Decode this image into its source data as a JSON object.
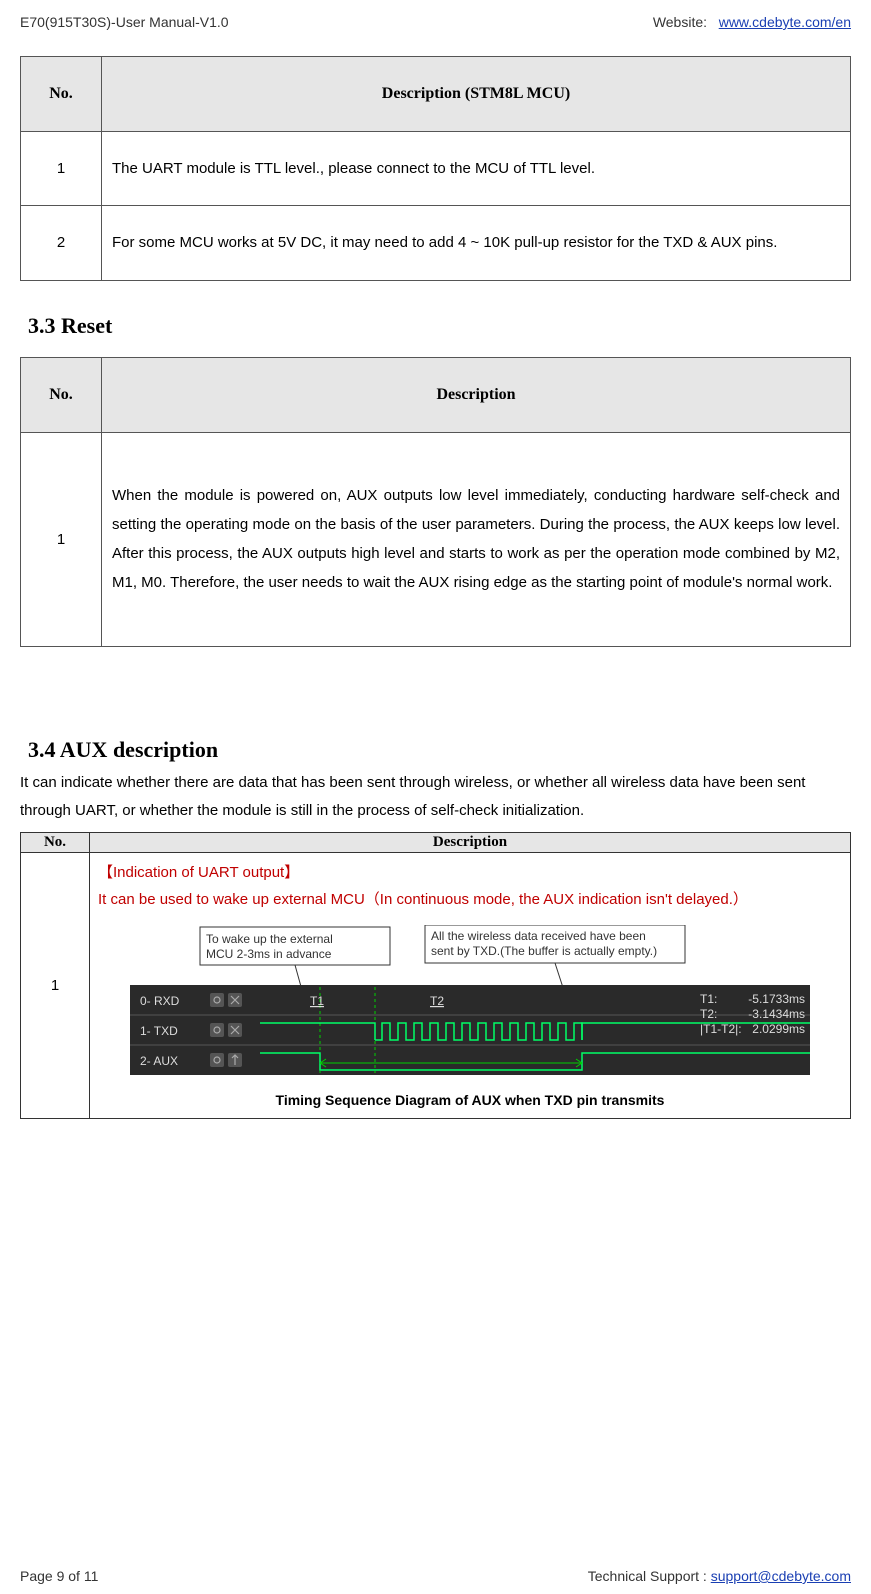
{
  "header": {
    "left": "E70(915T30S)-User Manual-V1.0",
    "right_label": "Website:",
    "right_link_text": "www.cdebyte.com/en"
  },
  "table1": {
    "head_no": "No.",
    "head_desc": "Description (STM8L MCU)",
    "rows": [
      {
        "no": "1",
        "desc": "The UART module is TTL level., please connect to the MCU of TTL level."
      },
      {
        "no": "2",
        "desc": "For some MCU works at 5V DC, it may need to add 4 ~ 10K pull-up resistor for the TXD & AUX pins."
      }
    ]
  },
  "section_reset": "3.3 Reset",
  "table_reset": {
    "head_no": "No.",
    "head_desc": "Description",
    "rows": [
      {
        "no": "1",
        "desc": "When the module is powered on, AUX outputs low level immediately, conducting hardware self-check and setting the operating mode on the basis of the user parameters. During the process, the AUX keeps low level. After this process, the AUX outputs high level and starts to work as per the operation mode combined by M2, M1, M0. Therefore, the user needs to wait the AUX rising edge as the starting point of module's normal work."
      }
    ]
  },
  "section_aux": "3.4 AUX description",
  "aux_body": "It can indicate whether there are data that has been sent through wireless, or whether all wireless data have been sent through UART, or whether the module is still in the process of self-check initialization.",
  "table_aux": {
    "head_no": "No.",
    "head_desc": "Description",
    "row1": {
      "no": "1",
      "red_title": "【Indication of UART output】",
      "red_line": "It can be used to wake up external MCU（In continuous mode, the AUX indication isn't delayed.）",
      "callout_left": "To wake up the external MCU 2-3ms in advance",
      "callout_right": "All the wireless data received have been sent by TXD.(The buffer is actually empty.)",
      "scope_labels": {
        "rxd": "0- RXD",
        "txd": "1- TXD",
        "aux": "2- AUX",
        "t1": "T1",
        "t2": "T2",
        "meas_t1_label": "T1:",
        "meas_t2_label": "T2:",
        "meas_dt_label": "|T1-T2|:",
        "meas_t1_val": "-5.1733ms",
        "meas_t2_val": "-3.1434ms",
        "meas_dt_val": "2.0299ms"
      },
      "caption": "Timing Sequence Diagram of AUX when TXD pin transmits"
    }
  },
  "footer": {
    "left": "Page 9 of 11",
    "right_label": "Technical Support : ",
    "right_link": "support@cdebyte.com"
  }
}
